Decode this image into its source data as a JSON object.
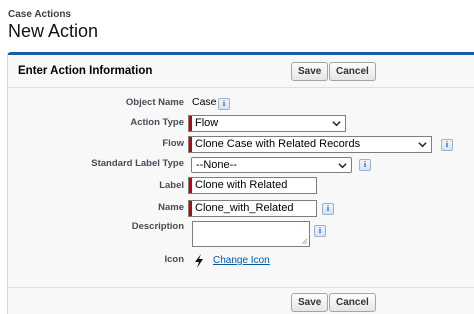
{
  "breadcrumb": "Case Actions",
  "title": "New Action",
  "panel": {
    "title": "Enter Action Information",
    "save_label": "Save",
    "cancel_label": "Cancel"
  },
  "form": {
    "object_name": {
      "label": "Object Name",
      "value": "Case"
    },
    "action_type": {
      "label": "Action Type",
      "value": "Flow"
    },
    "flow": {
      "label": "Flow",
      "value": "Clone Case with Related Records"
    },
    "standard_label_type": {
      "label": "Standard Label Type",
      "value": "--None--"
    },
    "label": {
      "label": "Label",
      "value": "Clone with Related"
    },
    "name": {
      "label": "Name",
      "value": "Clone_with_Related"
    },
    "description": {
      "label": "Description",
      "value": ""
    },
    "icon": {
      "label": "Icon",
      "link": "Change Icon"
    }
  },
  "info_glyph": "i",
  "colors": {
    "required": "#cc0000",
    "link": "#015ba7",
    "panel_accent": "#1a5aa8"
  },
  "icons": {
    "action_icon": "lightning-bolt-icon",
    "info": "info-icon",
    "dropdown": "chevron-down-icon"
  }
}
